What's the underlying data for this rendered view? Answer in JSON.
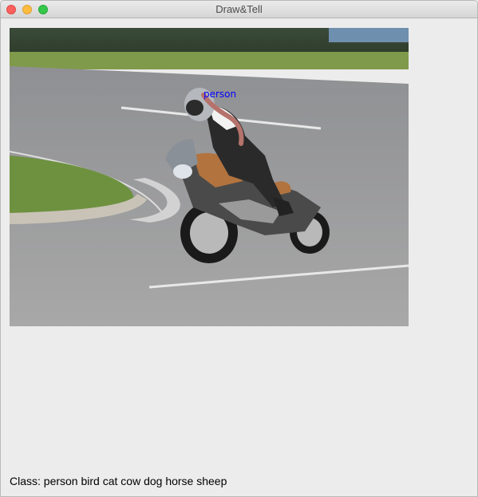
{
  "window": {
    "title": "Draw&Tell"
  },
  "canvas": {
    "annotation": {
      "label": "person",
      "label_color": "#0000ff",
      "stroke_color": "#b5736c"
    }
  },
  "status": {
    "text": "Class: person bird cat cow dog horse sheep"
  }
}
